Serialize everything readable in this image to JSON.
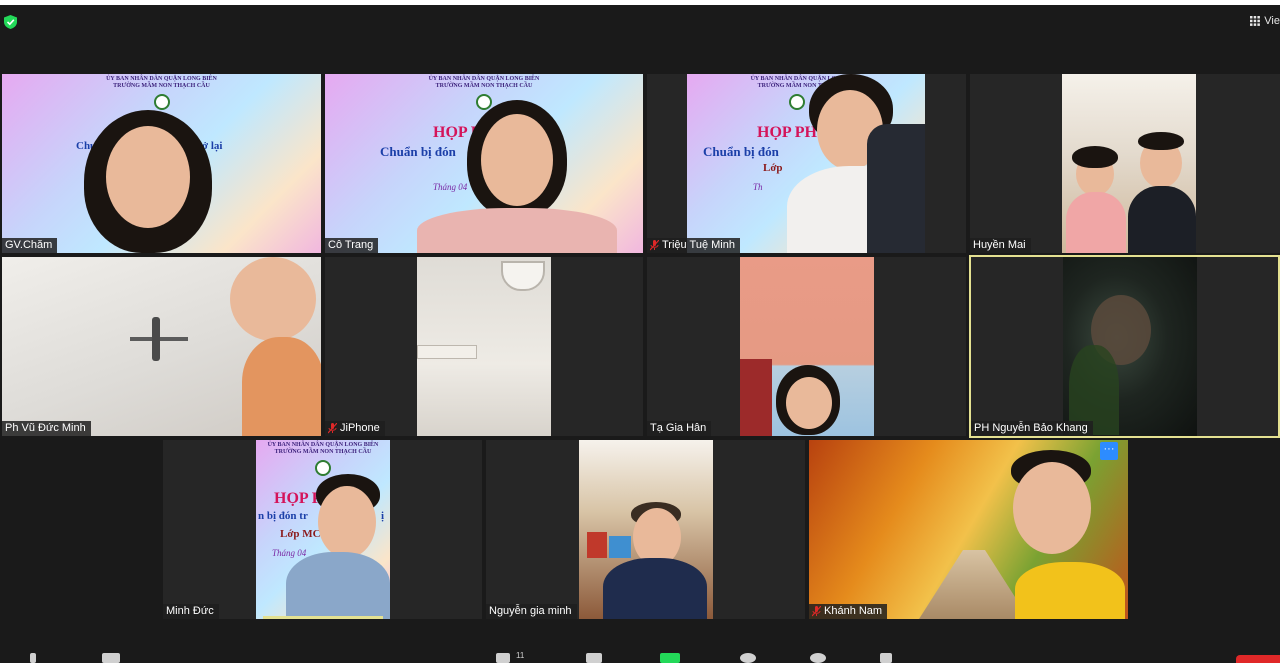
{
  "toolbar": {
    "view_label": "Vie",
    "view_icon": "grid-icon",
    "security_icon": "shield-icon",
    "colors": {
      "security": "#23d959",
      "active_speaker_border": "#e4e191",
      "more_button": "#2d8cff",
      "end_button": "#e02828"
    }
  },
  "banner": {
    "header_line1": "ỦY BAN NHÂN DÂN QUẬN LONG BIÊN",
    "header_line2": "TRƯỜNG MẦM NON THẠCH CẦU",
    "tiles": [
      {
        "title": "",
        "subtitle": "Chuẩ",
        "subtitle2": "ở lại",
        "class_label": "",
        "month": ""
      },
      {
        "title": "HỌP P",
        "subtitle": "Chuẩn bị đón",
        "subtitle2": "i",
        "class_label": "",
        "month": "Tháng 04"
      },
      {
        "title": "HỌP PH",
        "subtitle": "Chuẩn bị đón",
        "subtitle2": "",
        "class_label": "Lớp",
        "month": "Th"
      },
      {
        "title": "HỌP P",
        "subtitle": "n bị đón tr",
        "subtitle2": "ị",
        "class_label": "Lớp MC",
        "month": "Tháng 04"
      }
    ]
  },
  "participants": [
    {
      "name": "GV.Chăm",
      "muted": false
    },
    {
      "name": "Cô Trang",
      "muted": false
    },
    {
      "name": "Triệu Tuệ Minh",
      "muted": true
    },
    {
      "name": "Huyền Mai",
      "muted": false
    },
    {
      "name": "Ph Vũ Đức Minh",
      "muted": false
    },
    {
      "name": "JiPhone",
      "muted": true
    },
    {
      "name": "Tạ Gia Hân",
      "muted": false
    },
    {
      "name": "PH Nguyễn Bảo Khang",
      "muted": false,
      "active_speaker": true
    },
    {
      "name": "Minh Đức",
      "muted": false
    },
    {
      "name": "Nguyễn gia minh",
      "muted": false
    },
    {
      "name": "Khánh Nam",
      "muted": true,
      "more_label": "···"
    }
  ],
  "bottom_bar": {
    "participants_count": "11"
  }
}
